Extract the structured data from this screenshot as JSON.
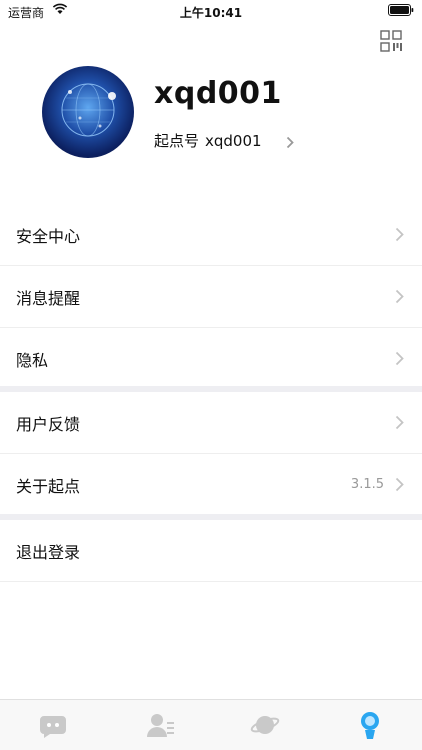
{
  "status_bar": {
    "carrier": "运营商",
    "time": "上午10:41"
  },
  "profile": {
    "username": "xqd001",
    "account_label": "起点号",
    "account_value": "xqd001"
  },
  "menu_groups": [
    [
      {
        "label": "安全中心",
        "value": ""
      },
      {
        "label": "消息提醒",
        "value": ""
      },
      {
        "label": "隐私",
        "value": ""
      }
    ],
    [
      {
        "label": "用户反馈",
        "value": ""
      },
      {
        "label": "关于起点",
        "value": "3.1.5"
      }
    ],
    [
      {
        "label": "退出登录",
        "value": ""
      }
    ]
  ],
  "tabs": [
    {
      "icon": "chat-icon",
      "active": false
    },
    {
      "icon": "contacts-icon",
      "active": false
    },
    {
      "icon": "planet-icon",
      "active": false
    },
    {
      "icon": "profile-icon",
      "active": true
    }
  ],
  "colors": {
    "accent": "#2aa6f0",
    "tab_inactive": "#c9c9c9",
    "separator": "#eeeef2",
    "chevron": "#c4c4c4"
  }
}
